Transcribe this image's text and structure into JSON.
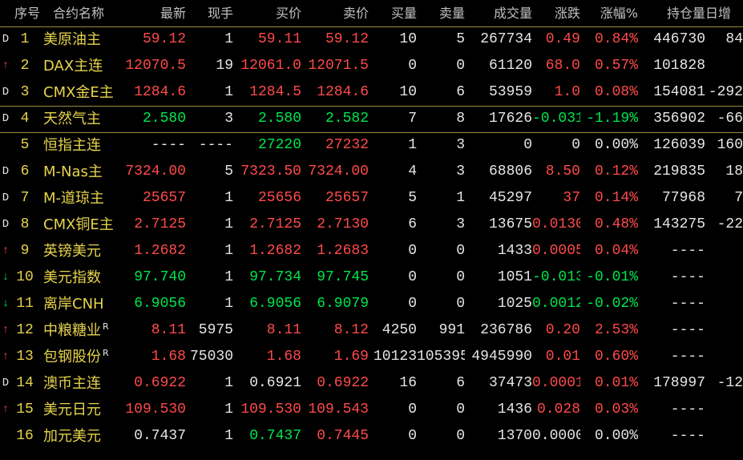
{
  "headers": [
    "序号",
    "合约名称",
    "最新",
    "现手",
    "买价",
    "卖价",
    "买量",
    "卖量",
    "成交量",
    "涨跌",
    "涨幅%",
    "持仓量",
    "日增"
  ],
  "colors": {
    "up": "#ff4a4a",
    "down": "#00e64d",
    "flat": "#e6e6e6",
    "label": "#e6d34c",
    "header": "#c0c0c0"
  },
  "rows": [
    {
      "mark": "D",
      "seq": "1",
      "name": "美原油主",
      "sup": "",
      "last": "59.12",
      "vol_hand": "1",
      "bid": "59.11",
      "ask": "59.12",
      "bid_vol": "10",
      "ask_vol": "5",
      "volume": "267734",
      "change": "0.49",
      "change_pct": "0.84%",
      "oi": "446730",
      "daily": "84",
      "dir": "up"
    },
    {
      "mark": "↑",
      "seq": "2",
      "name": "DAX主连",
      "sup": "",
      "last": "12070.5",
      "vol_hand": "19",
      "bid": "12061.0",
      "ask": "12071.5",
      "bid_vol": "0",
      "ask_vol": "0",
      "volume": "61120",
      "change": "68.0",
      "change_pct": "0.57%",
      "oi": "101828",
      "daily": "",
      "dir": "up"
    },
    {
      "mark": "D",
      "seq": "3",
      "name": "CMX金E主",
      "sup": "",
      "last": "1284.6",
      "vol_hand": "1",
      "bid": "1284.5",
      "ask": "1284.6",
      "bid_vol": "10",
      "ask_vol": "6",
      "volume": "53959",
      "change": "1.0",
      "change_pct": "0.08%",
      "oi": "154081",
      "daily": "-292",
      "dir": "up"
    },
    {
      "mark": "D",
      "seq": "4",
      "name": "天然气主",
      "sup": "",
      "last": "2.580",
      "vol_hand": "3",
      "bid": "2.580",
      "ask": "2.582",
      "bid_vol": "7",
      "ask_vol": "8",
      "volume": "17626",
      "change": "-0.031",
      "change_pct": "-1.19%",
      "oi": "356902",
      "daily": "-66",
      "dir": "down"
    },
    {
      "mark": "",
      "seq": "5",
      "name": "恒指主连",
      "sup": "",
      "last": "----",
      "vol_hand": "----",
      "bid": "27220",
      "ask": "27232",
      "bid_vol": "1",
      "ask_vol": "3",
      "volume": "0",
      "change": "0",
      "change_pct": "0.00%",
      "oi": "126039",
      "daily": "160",
      "dir": "flat"
    },
    {
      "mark": "D",
      "seq": "6",
      "name": "M-Nas主",
      "sup": "",
      "last": "7324.00",
      "vol_hand": "5",
      "bid": "7323.50",
      "ask": "7324.00",
      "bid_vol": "4",
      "ask_vol": "3",
      "volume": "68806",
      "change": "8.50",
      "change_pct": "0.12%",
      "oi": "219835",
      "daily": "18",
      "dir": "up"
    },
    {
      "mark": "D",
      "seq": "7",
      "name": "M-道琼主",
      "sup": "",
      "last": "25657",
      "vol_hand": "1",
      "bid": "25656",
      "ask": "25657",
      "bid_vol": "5",
      "ask_vol": "1",
      "volume": "45297",
      "change": "37",
      "change_pct": "0.14%",
      "oi": "77968",
      "daily": "7",
      "dir": "up"
    },
    {
      "mark": "D",
      "seq": "8",
      "name": "CMX铜E主",
      "sup": "",
      "last": "2.7125",
      "vol_hand": "1",
      "bid": "2.7125",
      "ask": "2.7130",
      "bid_vol": "6",
      "ask_vol": "3",
      "volume": "13675",
      "change": "0.0130",
      "change_pct": "0.48%",
      "oi": "143275",
      "daily": "-22",
      "dir": "up"
    },
    {
      "mark": "↑",
      "seq": "9",
      "name": "英镑美元",
      "sup": "",
      "last": "1.2682",
      "vol_hand": "1",
      "bid": "1.2682",
      "ask": "1.2683",
      "bid_vol": "0",
      "ask_vol": "0",
      "volume": "1433",
      "change": "0.0005",
      "change_pct": "0.04%",
      "oi": "----",
      "daily": "",
      "dir": "up"
    },
    {
      "mark": "↓",
      "seq": "10",
      "name": "美元指数",
      "sup": "",
      "last": "97.740",
      "vol_hand": "1",
      "bid": "97.734",
      "ask": "97.745",
      "bid_vol": "0",
      "ask_vol": "0",
      "volume": "1051",
      "change": "-0.013",
      "change_pct": "-0.01%",
      "oi": "----",
      "daily": "",
      "dir": "down"
    },
    {
      "mark": "↓",
      "seq": "11",
      "name": "离岸CNH",
      "sup": "",
      "last": "6.9056",
      "vol_hand": "1",
      "bid": "6.9056",
      "ask": "6.9079",
      "bid_vol": "0",
      "ask_vol": "0",
      "volume": "1025",
      "change": "0.0012",
      "change_pct": "-0.02%",
      "oi": "----",
      "daily": "",
      "dir": "down"
    },
    {
      "mark": "↑",
      "seq": "12",
      "name": "中粮糖业",
      "sup": "R",
      "last": "8.11",
      "vol_hand": "5975",
      "bid": "8.11",
      "ask": "8.12",
      "bid_vol": "4250",
      "ask_vol": "991",
      "volume": "236786",
      "change": "0.20",
      "change_pct": "2.53%",
      "oi": "----",
      "daily": "",
      "dir": "up"
    },
    {
      "mark": "↑",
      "seq": "13",
      "name": "包钢股份",
      "sup": "R",
      "last": "1.68",
      "vol_hand": "75030",
      "bid": "1.68",
      "ask": "1.69",
      "bid_vol": "10123",
      "ask_vol": "105395",
      "volume": "4945990",
      "change": "0.01",
      "change_pct": "0.60%",
      "oi": "----",
      "daily": "",
      "dir": "up"
    },
    {
      "mark": "D",
      "seq": "14",
      "name": "澳币主连",
      "sup": "",
      "last": "0.6922",
      "vol_hand": "1",
      "bid": "0.6921",
      "ask": "0.6922",
      "bid_vol": "16",
      "ask_vol": "6",
      "volume": "37473",
      "change": "0.0001",
      "change_pct": "0.01%",
      "oi": "178997",
      "daily": "-12",
      "dir": "up"
    },
    {
      "mark": "↑",
      "seq": "15",
      "name": "美元日元",
      "sup": "",
      "last": "109.530",
      "vol_hand": "1",
      "bid": "109.530",
      "ask": "109.543",
      "bid_vol": "0",
      "ask_vol": "0",
      "volume": "1436",
      "change": "0.028",
      "change_pct": "0.03%",
      "oi": "----",
      "daily": "",
      "dir": "up"
    },
    {
      "mark": "",
      "seq": "16",
      "name": "加元美元",
      "sup": "",
      "last": "0.7437",
      "vol_hand": "1",
      "bid": "0.7437",
      "ask": "0.7445",
      "bid_vol": "0",
      "ask_vol": "0",
      "volume": "1370",
      "change": "0.0000",
      "change_pct": "0.00%",
      "oi": "----",
      "daily": "",
      "dir": "flat"
    }
  ]
}
